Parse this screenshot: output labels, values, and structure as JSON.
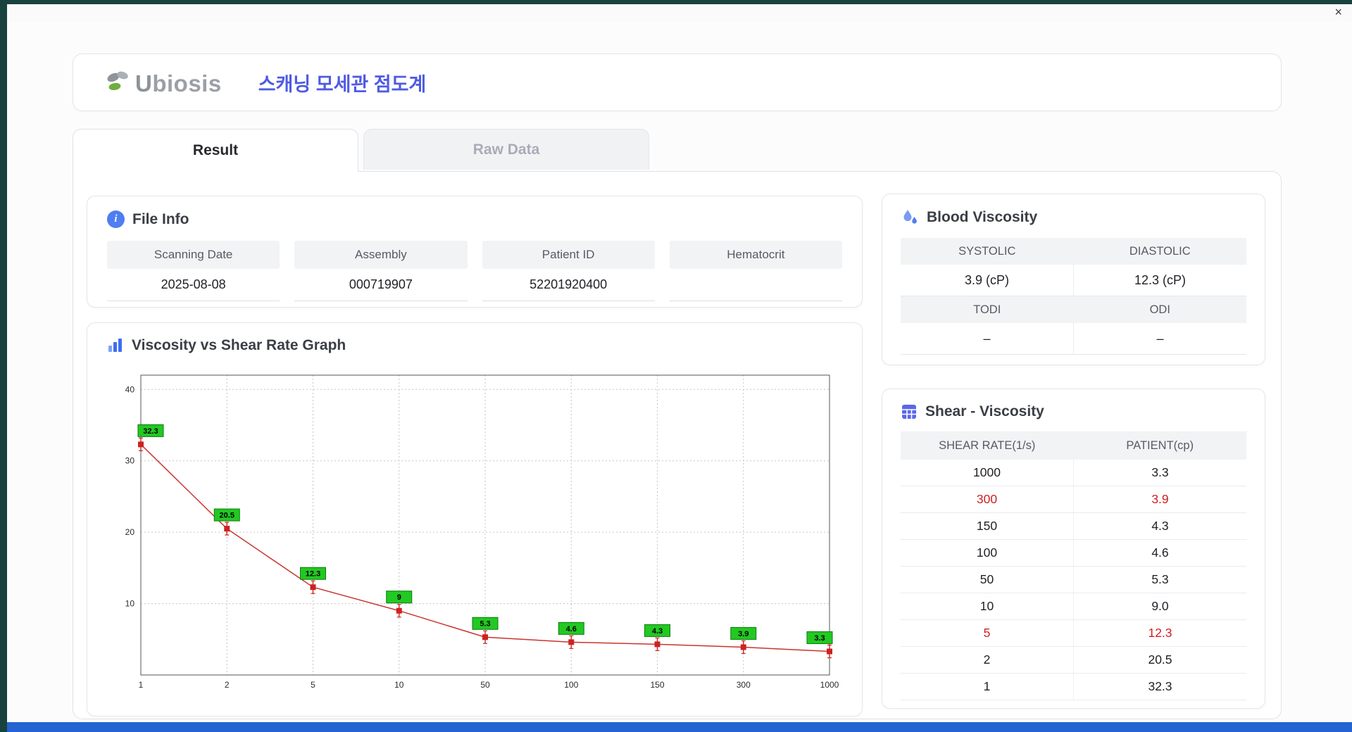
{
  "window": {
    "close_label": "×"
  },
  "header": {
    "logo_u": "U",
    "logo_rest": "biosis",
    "title": "스캐닝 모세관 점도계"
  },
  "tabs": [
    {
      "label": "Result",
      "active": true
    },
    {
      "label": "Raw Data",
      "active": false
    }
  ],
  "file_info": {
    "title": "File Info",
    "fields": [
      {
        "label": "Scanning Date",
        "value": "2025-08-08"
      },
      {
        "label": "Assembly",
        "value": "000719907"
      },
      {
        "label": "Patient ID",
        "value": "52201920400"
      },
      {
        "label": "Hematocrit",
        "value": ""
      }
    ]
  },
  "blood_viscosity": {
    "title": "Blood Viscosity",
    "groups": [
      {
        "h1": "SYSTOLIC",
        "h2": "DIASTOLIC",
        "v1": "3.9 (cP)",
        "v2": "12.3 (cP)"
      },
      {
        "h1": "TODI",
        "h2": "ODI",
        "v1": "–",
        "v2": "–"
      }
    ]
  },
  "graph": {
    "title": "Viscosity vs Shear Rate Graph"
  },
  "chart_data": {
    "type": "line",
    "title": "Viscosity vs Shear Rate Graph",
    "x": [
      1,
      2,
      5,
      10,
      50,
      100,
      150,
      300,
      1000
    ],
    "x_tick_labels": [
      "1",
      "2",
      "5",
      "10",
      "50",
      "100",
      "150",
      "300",
      "1000"
    ],
    "x_spacing": "equal",
    "values": [
      32.3,
      20.5,
      12.3,
      9,
      5.3,
      4.6,
      4.3,
      3.9,
      3.3
    ],
    "point_labels": [
      "32.3",
      "20.5",
      "12.3",
      "9",
      "5.3",
      "4.6",
      "4.3",
      "3.9",
      "3.3"
    ],
    "y_ticks": [
      10,
      20,
      30,
      40
    ],
    "ylim": [
      0,
      42
    ],
    "grid": true,
    "legend": false,
    "line_color": "#c9342f",
    "marker_color": "#cc2222",
    "point_label_bg": "#22c922",
    "point_label_border": "#0b7a0b",
    "point_label_text": "#000000"
  },
  "shear_table": {
    "title": "Shear - Viscosity",
    "columns": [
      "SHEAR RATE(1/s)",
      "PATIENT(cp)"
    ],
    "rows": [
      {
        "shear": "1000",
        "patient": "3.3",
        "highlight": false
      },
      {
        "shear": "300",
        "patient": "3.9",
        "highlight": true
      },
      {
        "shear": "150",
        "patient": "4.3",
        "highlight": false
      },
      {
        "shear": "100",
        "patient": "4.6",
        "highlight": false
      },
      {
        "shear": "50",
        "patient": "5.3",
        "highlight": false
      },
      {
        "shear": "10",
        "patient": "9.0",
        "highlight": false
      },
      {
        "shear": "5",
        "patient": "12.3",
        "highlight": true
      },
      {
        "shear": "2",
        "patient": "20.5",
        "highlight": false
      },
      {
        "shear": "1",
        "patient": "32.3",
        "highlight": false
      }
    ]
  },
  "colors": {
    "accent_blue": "#4f5be2",
    "icon_blue": "#4f7df2",
    "highlight_red": "#cf1f1f",
    "chart_line": "#c9342f",
    "chart_point_label": "#22c922",
    "taskbar_blue": "#2364d2",
    "desktop_teal": "#17423d"
  }
}
